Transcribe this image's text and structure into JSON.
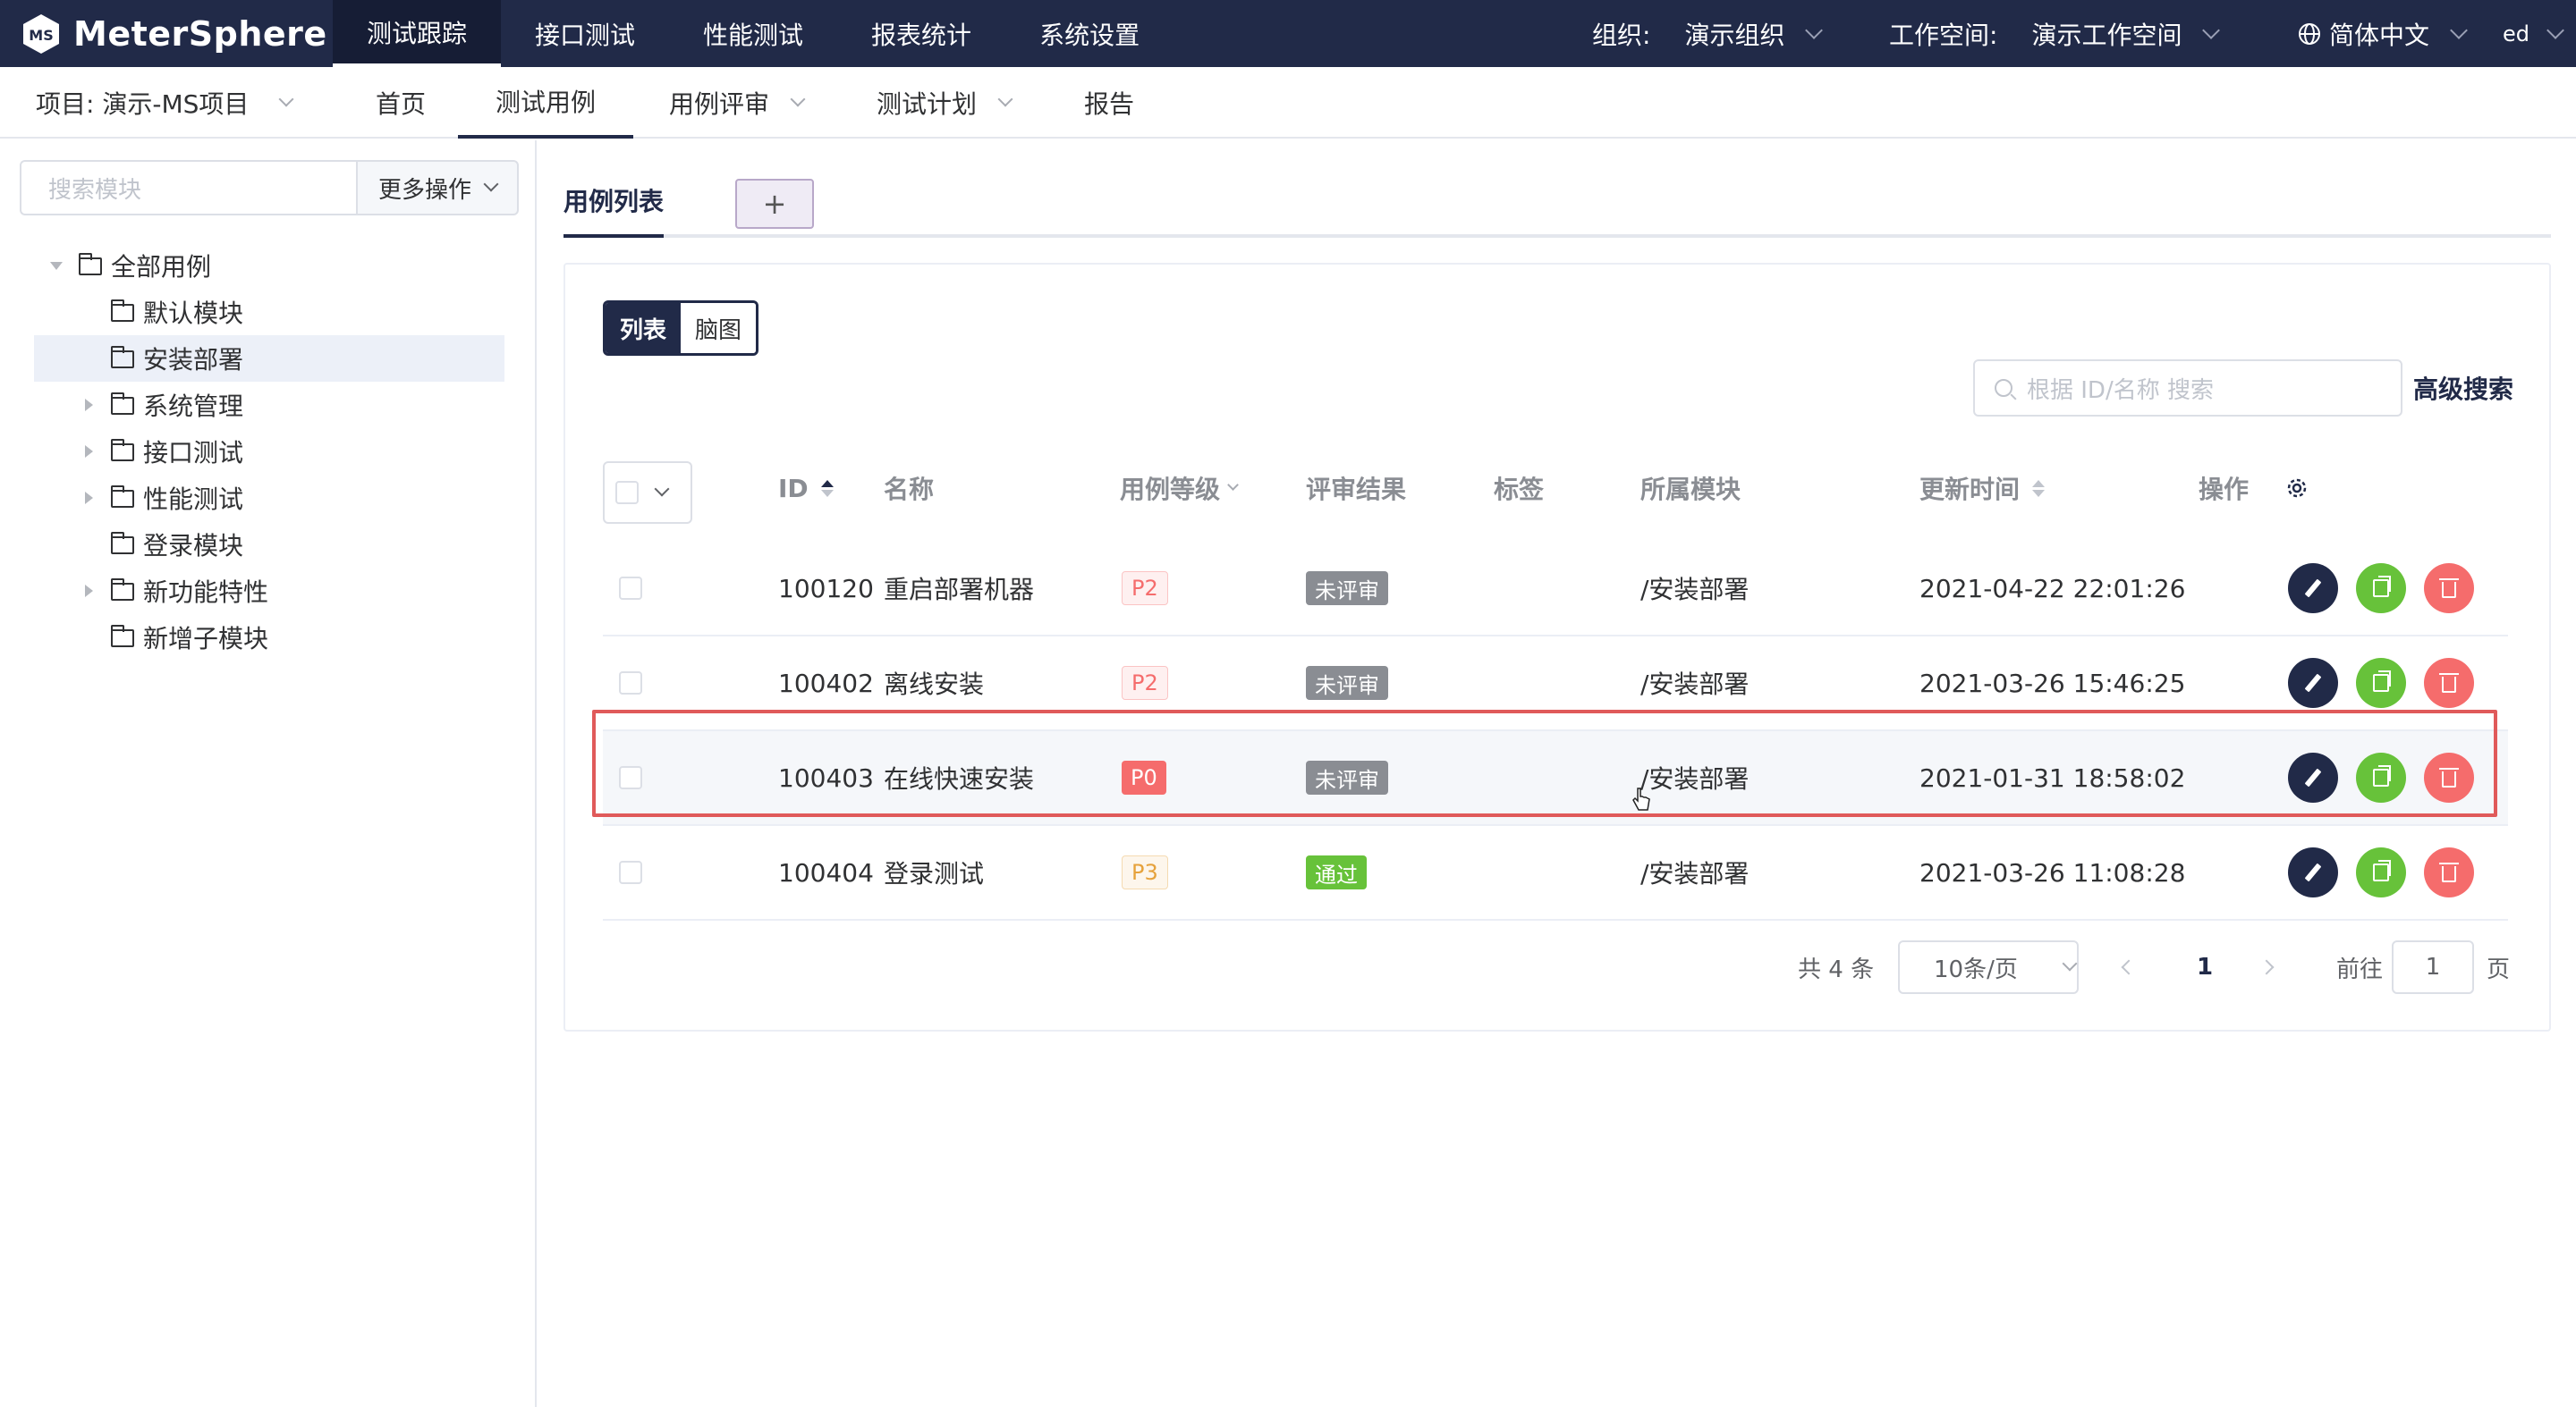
{
  "app": {
    "name": "MeterSphere",
    "logo_text": "MS"
  },
  "top_nav": [
    "测试跟踪",
    "接口测试",
    "性能测试",
    "报表统计",
    "系统设置"
  ],
  "top_nav_active": "测试跟踪",
  "org": {
    "label": "组织:",
    "value": "演示组织"
  },
  "workspace": {
    "label": "工作空间:",
    "value": "演示工作空间"
  },
  "language": "简体中文",
  "user": "ed",
  "sub_nav": {
    "project": "项目: 演示-MS项目",
    "items": [
      "首页",
      "测试用例",
      "用例评审",
      "测试计划",
      "报告"
    ],
    "active": "测试用例"
  },
  "sidebar": {
    "search_placeholder": "搜索模块",
    "more_ops": "更多操作",
    "tree": [
      {
        "label": "全部用例",
        "caret": "open"
      },
      {
        "label": "默认模块",
        "caret": "none"
      },
      {
        "label": "安装部署",
        "caret": "none",
        "selected": true
      },
      {
        "label": "系统管理",
        "caret": "closed"
      },
      {
        "label": "接口测试",
        "caret": "closed"
      },
      {
        "label": "性能测试",
        "caret": "closed"
      },
      {
        "label": "登录模块",
        "caret": "none"
      },
      {
        "label": "新功能特性",
        "caret": "closed"
      },
      {
        "label": "新增子模块",
        "caret": "none"
      }
    ]
  },
  "main": {
    "tab": "用例列表",
    "tab_add": "+",
    "view_toggle": {
      "list": "列表",
      "mind": "脑图"
    },
    "search_placeholder": "根据 ID/名称 搜索",
    "advanced_search": "高级搜索",
    "columns": {
      "id": "ID",
      "name": "名称",
      "level": "用例等级",
      "review": "评审结果",
      "tags": "标签",
      "module": "所属模块",
      "updated": "更新时间",
      "ops": "操作"
    },
    "rows": [
      {
        "id": "100120",
        "name": "重启部署机器",
        "level": "P2",
        "review": "未评审",
        "module": "/安装部署",
        "updated": "2021-04-22 22:01:26"
      },
      {
        "id": "100402",
        "name": "离线安装",
        "level": "P2",
        "review": "未评审",
        "module": "/安装部署",
        "updated": "2021-03-26 15:46:25"
      },
      {
        "id": "100403",
        "name": "在线快速安装",
        "level": "P0",
        "review": "未评审",
        "module": "/安装部署",
        "updated": "2021-01-31 18:58:02"
      },
      {
        "id": "100404",
        "name": "登录测试",
        "level": "P3",
        "review": "通过",
        "module": "/安装部署",
        "updated": "2021-03-26 11:08:28"
      }
    ],
    "pagination": {
      "total": "共 4 条",
      "page_size": "10条/页",
      "current": "1",
      "goto_label": "前往",
      "goto_value": "1",
      "page_suffix": "页"
    }
  },
  "colors": {
    "nav_bg": "#212a48",
    "danger": "#f56c6c",
    "success": "#67c23a",
    "highlight": "#e05a5a"
  }
}
